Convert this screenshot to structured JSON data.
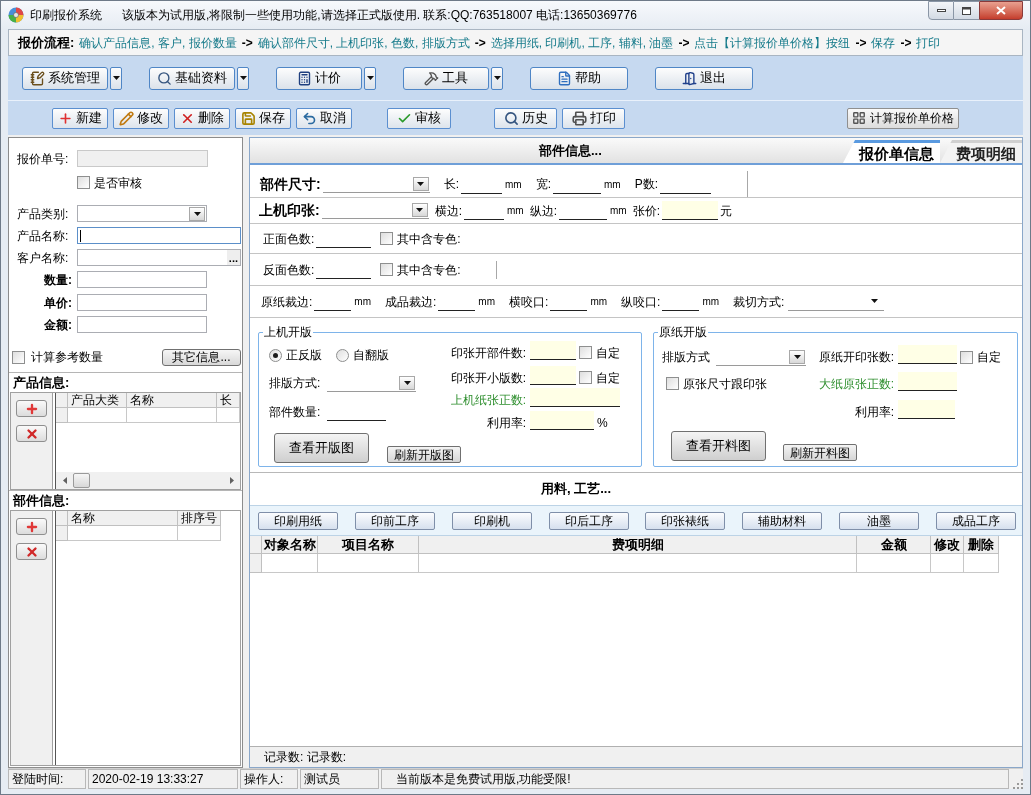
{
  "window": {
    "title": "印刷报价系统",
    "notice": "该版本为试用版,将限制一些使用功能,请选择正式版使用. 联系:QQ:763518007 电话:13650369776"
  },
  "flow": {
    "label": "报价流程:",
    "items": [
      {
        "kind": "step",
        "text": "确认产品信息, 客户, 报价数量"
      },
      {
        "kind": "arrow",
        "text": "->"
      },
      {
        "kind": "step",
        "text": "确认部件尺寸, 上机印张, 色数, 排版方式"
      },
      {
        "kind": "arrow",
        "text": "->"
      },
      {
        "kind": "step",
        "text": "选择用纸, 印刷机, 工序, 辅料, 油墨"
      },
      {
        "kind": "arrow",
        "text": "->"
      },
      {
        "kind": "step",
        "text": "点击【计算报价单价格】按纽"
      },
      {
        "kind": "arrow",
        "text": "->"
      },
      {
        "kind": "step",
        "text": "保存"
      },
      {
        "kind": "arrow",
        "text": "->"
      },
      {
        "kind": "step",
        "text": "打印"
      }
    ]
  },
  "main_toolbar": [
    {
      "label": "系统管理",
      "dropdown": true
    },
    {
      "label": "基础资料",
      "dropdown": true
    },
    {
      "label": "计价",
      "dropdown": true
    },
    {
      "label": "工具",
      "dropdown": true
    },
    {
      "label": "帮助",
      "dropdown": false
    },
    {
      "label": "退出",
      "dropdown": false
    }
  ],
  "action_toolbar": {
    "groups": [
      [
        "新建",
        "修改",
        "删除",
        "保存",
        "取消"
      ],
      [
        "审核"
      ],
      [
        "历史",
        "打印"
      ]
    ],
    "calc_button": "计算报价单价格"
  },
  "left_panel": {
    "fields": [
      {
        "kind": "text",
        "label": "报价单号:",
        "disabled": true,
        "focused": false
      },
      {
        "kind": "checkbox",
        "label": "是否审核",
        "checked": false
      },
      {
        "kind": "select",
        "label": "产品类别:"
      },
      {
        "kind": "text",
        "label": "产品名称:",
        "disabled": false,
        "focused": true
      },
      {
        "kind": "lookup",
        "label": "客户名称:",
        "button": "..."
      },
      {
        "kind": "amount",
        "label": "数量:"
      },
      {
        "kind": "amount",
        "label": "单价:"
      },
      {
        "kind": "amount",
        "label": "金额:"
      }
    ],
    "ref_checkbox": {
      "label": "计算参考数量",
      "checked": false
    },
    "other_button": "其它信息...",
    "product_grid": {
      "title": "产品信息:",
      "columns": [
        "产品大类",
        "名称",
        "长"
      ]
    },
    "part_grid": {
      "title": "部件信息:",
      "columns": [
        "名称",
        "排序号"
      ]
    }
  },
  "part_panel": {
    "title": "部件信息...",
    "tabs": [
      {
        "label": "报价单信息",
        "selected": true
      },
      {
        "label": "费项明细",
        "selected": false
      }
    ],
    "rows": [
      [
        {
          "kind": "heading_select",
          "label": "部件尺寸:"
        },
        {
          "kind": "input",
          "label": "长:",
          "unit": "mm"
        },
        {
          "kind": "input",
          "label": "宽:",
          "unit": "mm"
        },
        {
          "kind": "input",
          "label": "P数:"
        }
      ],
      [
        {
          "kind": "heading_select",
          "label": "上机印张:"
        },
        {
          "kind": "input",
          "label": "横边:",
          "unit": "mm"
        },
        {
          "kind": "input",
          "label": "纵边:",
          "unit": "mm"
        },
        {
          "kind": "computed",
          "label": "张价:",
          "unit": "元"
        }
      ],
      [
        {
          "kind": "input",
          "label": "正面色数:"
        },
        {
          "kind": "checkbox",
          "label": "其中含专色:",
          "checked": false
        }
      ],
      [
        {
          "kind": "input",
          "label": "反面色数:"
        },
        {
          "kind": "checkbox",
          "label": "其中含专色:",
          "checked": false
        }
      ],
      [
        {
          "kind": "input",
          "label": "原纸裁边:",
          "unit": "mm"
        },
        {
          "kind": "input",
          "label": "成品裁边:",
          "unit": "mm"
        },
        {
          "kind": "input",
          "label": "横咬口:",
          "unit": "mm"
        },
        {
          "kind": "input",
          "label": "纵咬口:",
          "unit": "mm"
        },
        {
          "kind": "flat_select",
          "label": "裁切方式:"
        }
      ]
    ]
  },
  "press_layout": {
    "title": "上机开版",
    "radios": [
      {
        "label": "正反版",
        "selected": true
      },
      {
        "label": "自翻版",
        "selected": false
      }
    ],
    "left_fields": [
      {
        "kind": "select",
        "label": "排版方式:"
      },
      {
        "kind": "input",
        "label": "部件数量:"
      }
    ],
    "right_fields": [
      {
        "label": "印张开部件数:",
        "checkbox": {
          "label": "自定",
          "checked": false
        }
      },
      {
        "label": "印张开小版数:",
        "checkbox": {
          "label": "自定",
          "checked": false
        }
      },
      {
        "label": "上机纸张正数:",
        "color": "#2f8f2f"
      },
      {
        "label": "利用率:",
        "unit": "%"
      }
    ],
    "buttons": [
      {
        "kind": "large",
        "label": "查看开版图"
      },
      {
        "kind": "small",
        "label": "刷新开版图"
      }
    ]
  },
  "paper_layout": {
    "title": "原纸开版",
    "select": {
      "label": "排版方式"
    },
    "follow_checkbox": {
      "label": "原张尺寸跟印张",
      "checked": false
    },
    "right_fields": [
      {
        "label": "原纸开印张数:",
        "checkbox": {
          "label": "自定",
          "checked": false
        }
      },
      {
        "label": "大纸原张正数:",
        "color": "#2f8f2f"
      },
      {
        "label": "利用率:"
      }
    ],
    "buttons": [
      {
        "kind": "large",
        "label": "查看开料图"
      },
      {
        "kind": "small",
        "label": "刷新开料图"
      }
    ]
  },
  "materials": {
    "title": "用料, 工艺...",
    "buttons": [
      "印刷用纸",
      "印前工序",
      "印刷机",
      "印后工序",
      "印张裱纸",
      "辅助材料",
      "油墨",
      "成品工序"
    ],
    "table": {
      "columns": [
        "对象名称",
        "项目名称",
        "费项明细",
        "金额",
        "修改",
        "删除"
      ]
    },
    "footer": "记录数: 记录数:"
  },
  "status_bar": [
    "登陆时间:",
    "2020-02-19 13:33:27",
    "操作人:",
    "测试员",
    "当前版本是免费试用版,功能受限!"
  ]
}
